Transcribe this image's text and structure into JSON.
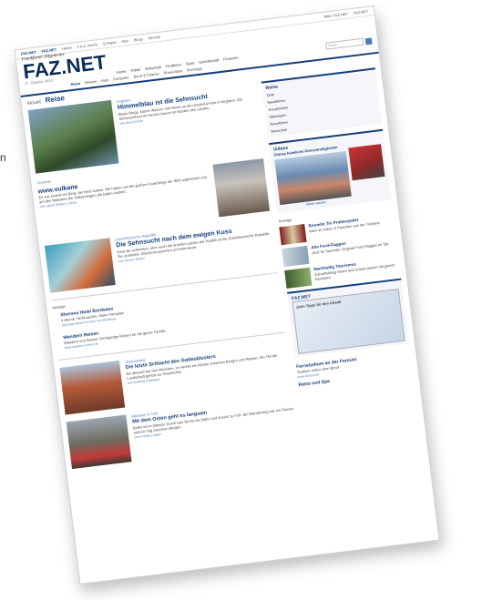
{
  "margin_text": {
    "top": "n"
  },
  "page": {
    "topnav": [
      "FAZ.NET",
      "FAZ.NET",
      "Home",
      "F.A.Z.-Archiv",
      "E-Paper",
      "Abo",
      "Blogs",
      "Service",
      "Mein FAZ.NET",
      "FAZ.NET"
    ],
    "logo_small": "Frankfurter Allgemeine",
    "logo": "FAZ.NET",
    "date": "27. Oktober 2010",
    "mainnav": [
      "Home",
      "Politik",
      "Wirtschaft",
      "Feuilleton",
      "Sport",
      "Gesellschaft",
      "Finanzen"
    ],
    "search_placeholder": "Suche",
    "subnav": [
      "Reise",
      "Wissen",
      "Auto",
      "Computer",
      "Beruf & Chance",
      "Rhein-Main",
      "Sonntags",
      "Rhein-Main"
    ],
    "subnav_active": "Reise",
    "crumb_prefix": "Aktuell",
    "crumb": "Reise",
    "lead": {
      "kicker": "Kirgisien",
      "headline": "Himmelblau ist die Sehnsucht",
      "text": "Blaue Berge, klares Wasser: Die Reise an den Issyk-Kul-See in Kirgisien. Der Sehnsuchtsort im Herzen Asiens im Norden des Landes.",
      "more": "Von Bernd Fritze"
    },
    "section": {
      "kicker": "Terminal",
      "title": "www.vulkane",
      "text": "Es war einmal ein Berg, der hieß Vulkan. Wir haben uns die großen Feuerberge der Welt angesehen und auf den Websites der Vulkanologen die Daten studiert.",
      "more": "Von Jakob Strobel y Serra"
    },
    "dom": {
      "kicker": "Dominikanische Republik",
      "headline": "Die Sehnsucht nach dem ewigen Kuss",
      "text": "Einst die schönsten, aber auch die ärmsten Länder der Karibik ist die Dominikanische Republik. Sie ist beides: Glücksversprechen und Abenteuer.",
      "more": "Von Jochen Hieber"
    },
    "ads_label": "Anzeige",
    "ad1": {
      "title": "Sherona Hotel Bordeaux",
      "text": "4 Sterne, Nichtraucher, Nähe Parkplatz",
      "more": "Günstige Reise ins Herz von Bordeaux"
    },
    "ad2": {
      "title": "Wandern Reisen",
      "text": "Wandern und Reisen: Einzigartige Reisen für die ganze Familie.",
      "more": "www.wandern-reisen.de"
    },
    "teaser1": {
      "kicker": "Verdunstung",
      "headline": "Die letzte Schlacht des Gottesklosters",
      "text": "Ein Besuch bei den Mönchen, im Herbst ein Kloster zwischen Bergen und Wasser. Ein Teil der Landschaft gehört zur Geschichte.",
      "more": "Von Andreas Platthaus"
    },
    "teaser2": {
      "kicker": "Wandern in Tirol",
      "headline": "Mit dem Osten geht es langsam",
      "text": "Berlin ist im Zillertal: Durch das Tal mit der Bahn und zurück zu Fuß. Ein Wanderweg wie ein Roman und ein Tag zwischen Bergen.",
      "more": "Von Freddy Langer"
    },
    "box_reise": {
      "title": "Reise",
      "links": [
        "Ziele",
        "Reiseführer",
        "Kreuzfahrten",
        "Mietwagen",
        "Reiseführer",
        "Reiseziele"
      ]
    },
    "box_videos": {
      "title": "Videos",
      "video_title": "Chinas heimliche Grenzstreitigkeiten",
      "button": "Video starten"
    },
    "shop_label": "Anzeige",
    "shop": [
      {
        "title": "Brunello Tre Probierpaket",
        "text": "Wein im Paket, 6 Flaschen aus der Toskana"
      },
      {
        "title": "Alte Ford-Flaggen",
        "text": "Jetzt für Sammler: Original Ford-Flaggen im Set"
      },
      {
        "title": "Nachhaltig Tourismus",
        "text": "Zukunftsfähig reisen und Urlaub planen mit gutem Gewissen"
      }
    ],
    "faznet_box": "FAZ.NET",
    "faznet_promo": "Zehn Tipps für den Urlaub",
    "bottom_ad": {
      "title": "Fernstudium an der FernUni",
      "text": "Studium neben dem Beruf",
      "more": "www.fernuni.de"
    },
    "bottom_ad2": "Reise und Spa"
  }
}
